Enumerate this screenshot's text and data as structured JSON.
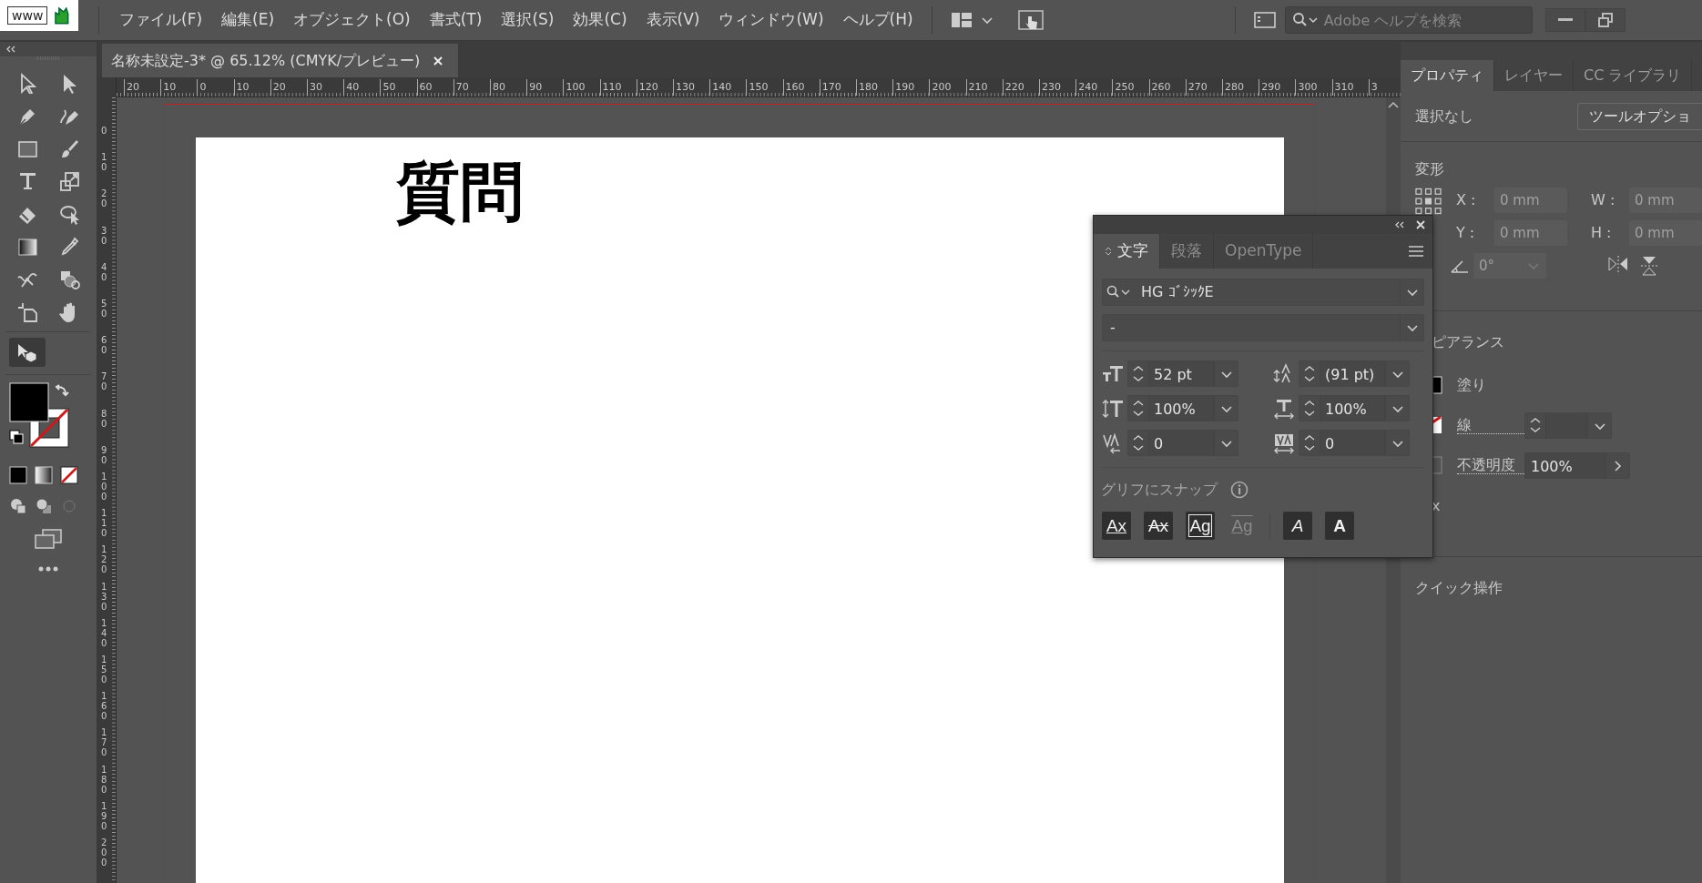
{
  "logo": {
    "text": "www"
  },
  "menu": [
    {
      "label": "ファイル(F)"
    },
    {
      "label": "編集(E)"
    },
    {
      "label": "オブジェクト(O)"
    },
    {
      "label": "書式(T)"
    },
    {
      "label": "選択(S)"
    },
    {
      "label": "効果(C)"
    },
    {
      "label": "表示(V)"
    },
    {
      "label": "ウィンドウ(W)"
    },
    {
      "label": "ヘルプ(H)"
    }
  ],
  "help_search": {
    "placeholder": "Adobe ヘルプを検索"
  },
  "document_tab": {
    "title": "名称未設定-3* @ 65.12% (CMYK/プレビュー)",
    "selected": true
  },
  "rulers": {
    "horizontal": [
      "20",
      "10",
      "0",
      "10",
      "20",
      "30",
      "40",
      "50",
      "60",
      "70",
      "80",
      "90",
      "100",
      "110",
      "120",
      "130",
      "140",
      "150",
      "160",
      "170",
      "180",
      "190",
      "200",
      "210",
      "220",
      "230",
      "240",
      "250",
      "260",
      "270",
      "280",
      "290",
      "300",
      "310",
      "3"
    ],
    "vertical": [
      "0",
      "10",
      "20",
      "30",
      "40",
      "50",
      "60",
      "70",
      "80",
      "90",
      "100",
      "110",
      "120",
      "130",
      "140",
      "150",
      "160",
      "170",
      "180",
      "190",
      "200"
    ]
  },
  "artboard": {
    "heading": "質問"
  },
  "character_panel": {
    "tabs": [
      {
        "label": "文字",
        "selected": true
      },
      {
        "label": "段落",
        "selected": false
      },
      {
        "label": "OpenType",
        "selected": false
      }
    ],
    "font_family": "HG ｺﾞｼｯｸE",
    "font_style": "-",
    "fields": [
      {
        "kind": "size",
        "value": "52 pt"
      },
      {
        "kind": "leading",
        "value": "(91 pt)"
      },
      {
        "kind": "vertical_scale",
        "value": "100%"
      },
      {
        "kind": "horizontal_scale",
        "value": "100%"
      },
      {
        "kind": "kerning",
        "value": "0"
      },
      {
        "kind": "tracking",
        "value": "0"
      }
    ],
    "snap_label": "グリフにスナップ",
    "snap_buttons": [
      {
        "kind": "baseline",
        "label": "Ax",
        "on": true
      },
      {
        "kind": "x_height",
        "label": "Ax",
        "on": true
      },
      {
        "kind": "em_box",
        "label": "Ag",
        "on": true
      },
      {
        "kind": "glyph_bounds",
        "label": "Ag",
        "on": false
      },
      {
        "kind": "angular",
        "label": "A",
        "on": true
      },
      {
        "kind": "anchor",
        "label": "A",
        "on": true
      }
    ]
  },
  "properties_panel": {
    "tabs": [
      {
        "label": "プロパティ",
        "selected": true
      },
      {
        "label": "レイヤー",
        "selected": false
      },
      {
        "label": "CC ライブラリ",
        "selected": false
      }
    ],
    "selection": "選択なし",
    "tool_options_button": "ツールオプショ",
    "transform_title": "変形",
    "transform_fields": [
      {
        "label": "X :",
        "value": "0 mm",
        "disabled": true
      },
      {
        "label": "W :",
        "value": "0 mm",
        "disabled": true
      },
      {
        "label": "Y :",
        "value": "0 mm",
        "disabled": true
      },
      {
        "label": "H :",
        "value": "0 mm",
        "disabled": true
      }
    ],
    "angle": {
      "value": "0°",
      "disabled": true
    },
    "appearance_title": "ピアランス",
    "appearance_rows": [
      {
        "kind": "fill",
        "label": "塗り"
      },
      {
        "kind": "stroke",
        "label": "線"
      },
      {
        "kind": "opacity",
        "label": "不透明度",
        "value": "100%"
      }
    ],
    "fx_label": "x",
    "quick_actions_title": "クイック操作"
  }
}
